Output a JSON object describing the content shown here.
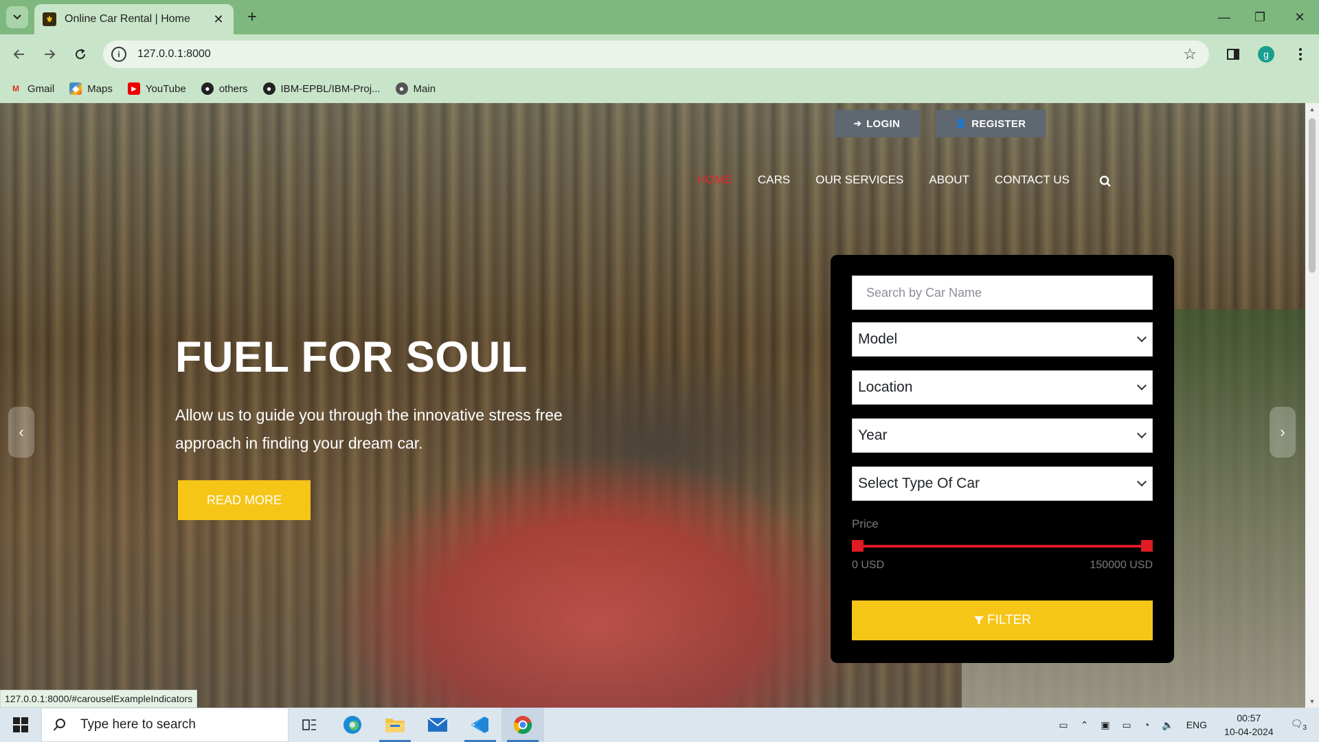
{
  "browser": {
    "tab_title": "Online Car Rental | Home",
    "url": "127.0.0.1:8000",
    "profile_initial": "g",
    "bookmarks": [
      {
        "label": "Gmail",
        "icon": "gmail-icon"
      },
      {
        "label": "Maps",
        "icon": "maps-icon"
      },
      {
        "label": "YouTube",
        "icon": "youtube-icon"
      },
      {
        "label": "others",
        "icon": "github-icon"
      },
      {
        "label": "IBM-EPBL/IBM-Proj...",
        "icon": "github-icon"
      },
      {
        "label": "Main",
        "icon": "github-icon"
      }
    ],
    "status_url": "127.0.0.1:8000/#carouselExampleIndicators"
  },
  "header": {
    "login_label": "LOGIN",
    "register_label": "REGISTER",
    "nav": [
      "HOME",
      "CARS",
      "OUR SERVICES",
      "ABOUT",
      "CONTACT US"
    ],
    "active_nav": "HOME"
  },
  "hero": {
    "title": "FUEL FOR SOUL",
    "text": "Allow us to guide you through the innovative stress free approach in finding your dream car.",
    "button": "READ MORE"
  },
  "filter": {
    "search_placeholder": "Search by Car Name",
    "model": "Model",
    "location": "Location",
    "year": "Year",
    "car_type": "Select Type Of Car",
    "price_label": "Price",
    "price_min": "0 USD",
    "price_max": "150000 USD",
    "button": "FILTER"
  },
  "taskbar": {
    "search_placeholder": "Type here to search",
    "language": "ENG",
    "time": "00:57",
    "date": "10-04-2024",
    "notifications": "3"
  },
  "colors": {
    "accent_yellow": "#f5c518",
    "active_red": "#e02a2a",
    "chrome_green": "#7eb87e"
  }
}
